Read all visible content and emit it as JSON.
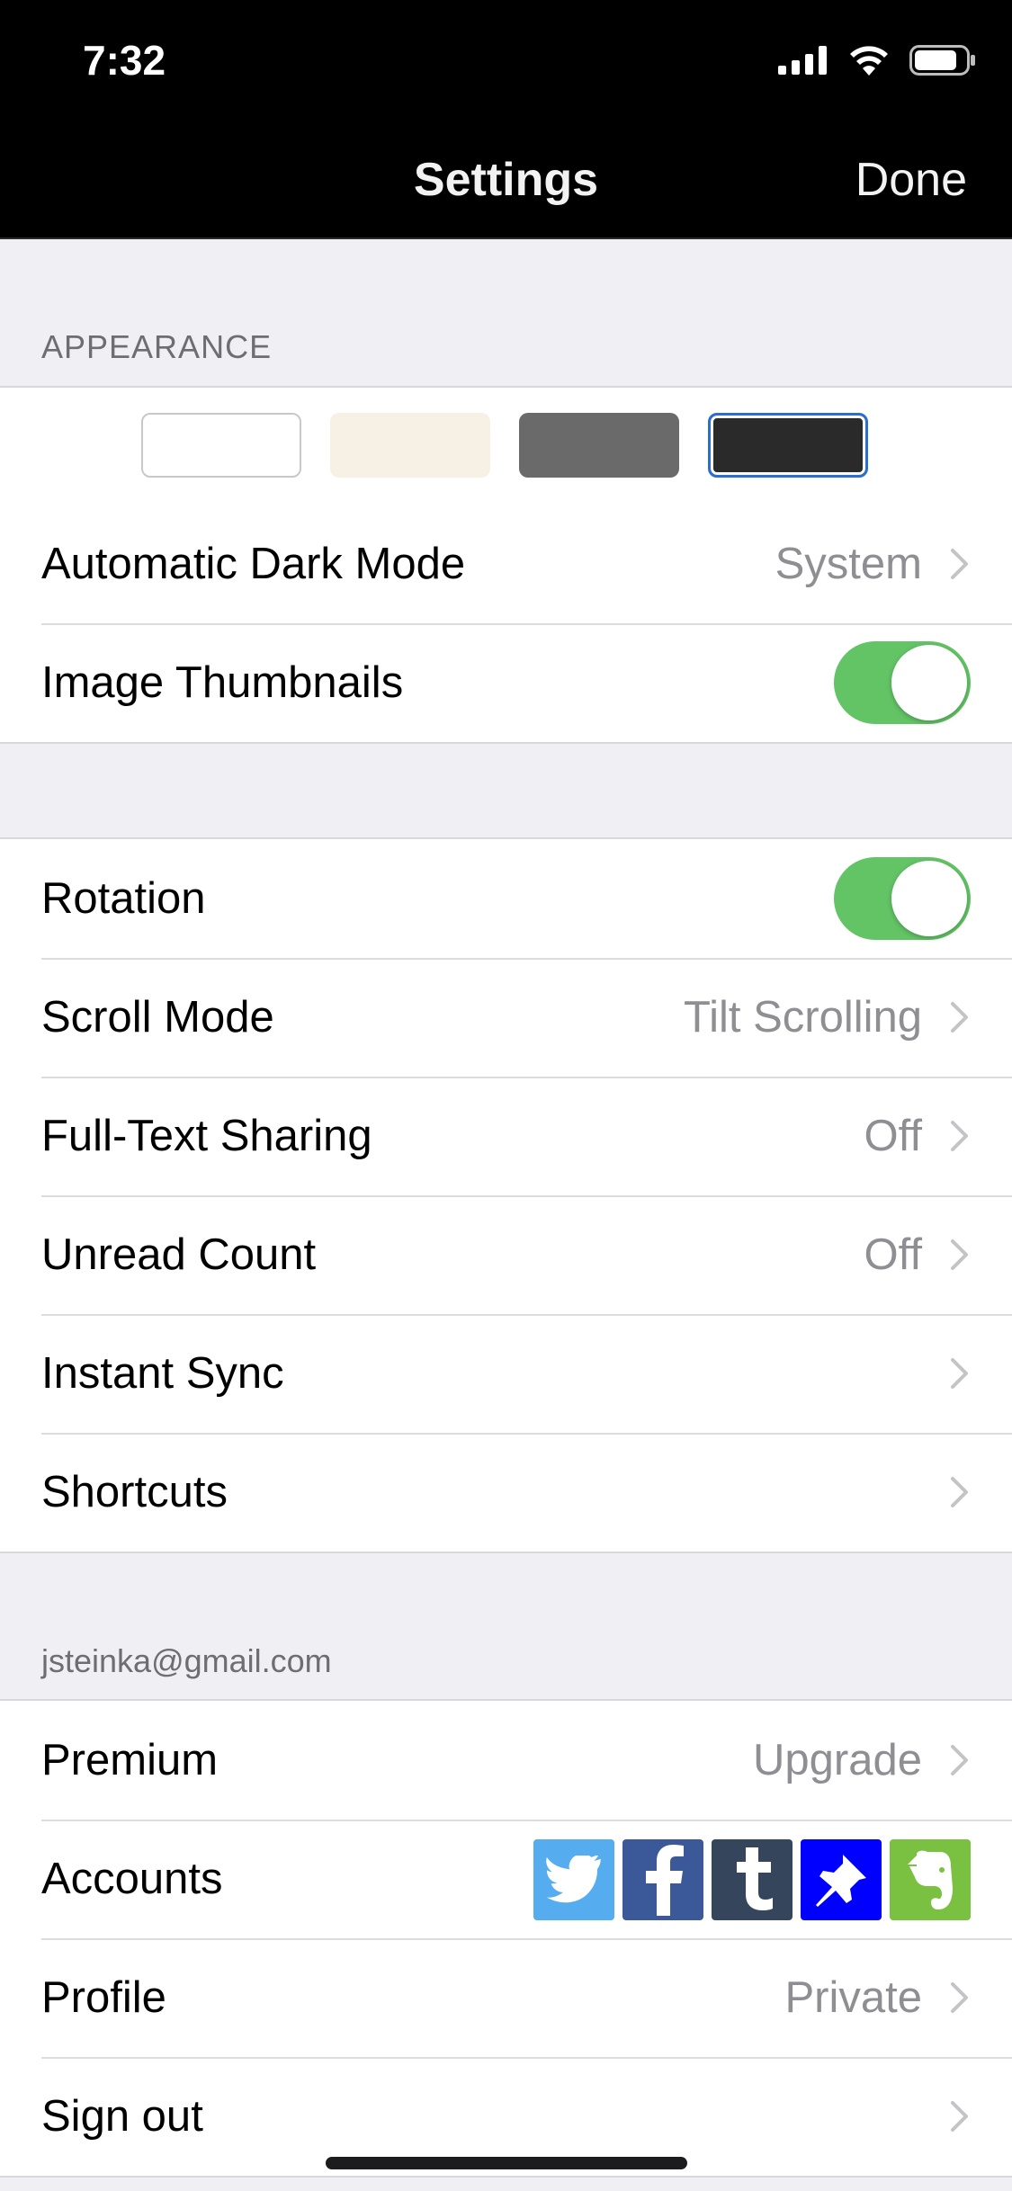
{
  "status": {
    "time": "7:32"
  },
  "nav": {
    "title": "Settings",
    "done": "Done"
  },
  "appearance": {
    "header": "APPEARANCE",
    "swatches": [
      {
        "name": "white",
        "color": "#ffffff"
      },
      {
        "name": "sepia",
        "color": "#f7f0e4"
      },
      {
        "name": "gray",
        "color": "#6a6a6a"
      },
      {
        "name": "dark",
        "color": "#2a2a2a",
        "selected": true
      }
    ],
    "rows": [
      {
        "label": "Automatic Dark Mode",
        "value": "System"
      },
      {
        "label": "Image Thumbnails",
        "toggle": true
      }
    ]
  },
  "reading": {
    "rows": [
      {
        "label": "Rotation",
        "toggle": true
      },
      {
        "label": "Scroll Mode",
        "value": "Tilt Scrolling"
      },
      {
        "label": "Full-Text Sharing",
        "value": "Off"
      },
      {
        "label": "Unread Count",
        "value": "Off"
      },
      {
        "label": "Instant Sync",
        "value": ""
      },
      {
        "label": "Shortcuts",
        "value": ""
      }
    ]
  },
  "account": {
    "header": "jsteinka@gmail.com",
    "rows": [
      {
        "label": "Premium",
        "value": "Upgrade"
      },
      {
        "label": "Accounts"
      },
      {
        "label": "Profile",
        "value": "Private"
      },
      {
        "label": "Sign out",
        "value": ""
      }
    ],
    "services": [
      {
        "icon": "twitter-icon",
        "color": "#55acee"
      },
      {
        "icon": "facebook-icon",
        "color": "#3b5998"
      },
      {
        "icon": "tumblr-icon",
        "color": "#35465c"
      },
      {
        "icon": "pinboard-icon",
        "color": "#0000ff"
      },
      {
        "icon": "evernote-icon",
        "color": "#7ac142"
      }
    ]
  },
  "colors": {
    "toggle_on": "#63c466",
    "secondary_text": "#8e8e93"
  }
}
